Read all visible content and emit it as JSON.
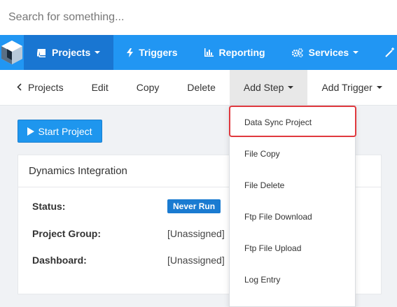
{
  "search": {
    "placeholder": "Search for something..."
  },
  "nav": {
    "items": [
      {
        "label": "Projects",
        "icon": "book-icon",
        "active": true,
        "has_caret": true
      },
      {
        "label": "Triggers",
        "icon": "bolt-icon",
        "active": false,
        "has_caret": false
      },
      {
        "label": "Reporting",
        "icon": "bar-chart-icon",
        "active": false,
        "has_caret": false
      },
      {
        "label": "Services",
        "icon": "cogs-icon",
        "active": false,
        "has_caret": true
      }
    ],
    "color": "#2196f3",
    "active_color": "#1976d2"
  },
  "toolbar": {
    "back_label": "Projects",
    "edit_label": "Edit",
    "copy_label": "Copy",
    "delete_label": "Delete",
    "add_step_label": "Add Step",
    "add_trigger_label": "Add Trigger"
  },
  "start_button_label": "Start Project",
  "panel": {
    "title": "Dynamics Integration",
    "status_label": "Status:",
    "status_value": "Never Run",
    "group_label": "Project Group:",
    "group_value": "[Unassigned]",
    "dashboard_label": "Dashboard:",
    "dashboard_value": "[Unassigned]"
  },
  "add_step_menu": {
    "items": [
      "Data Sync Project",
      "File Copy",
      "File Delete",
      "Ftp File Download",
      "Ftp File Upload",
      "Log Entry"
    ],
    "highlighted_index": 0,
    "highlight_color": "#e0393e"
  }
}
